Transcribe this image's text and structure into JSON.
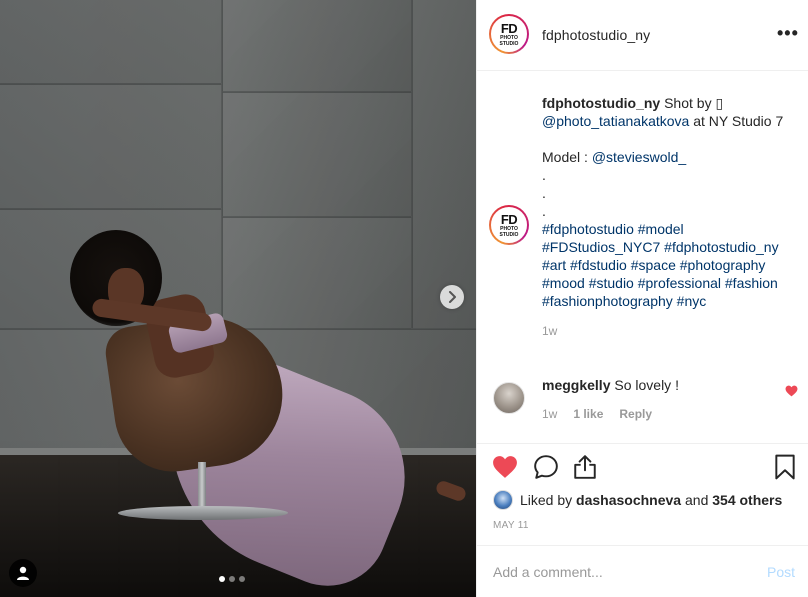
{
  "post": {
    "username": "fdphotostudio_ny",
    "avatar_logo": {
      "main": "FD",
      "sub_line1": "PHOTO",
      "sub_line2": "STUDIO"
    },
    "more_label": "•••"
  },
  "caption": {
    "username": "fdphotostudio_ny",
    "line1_text": " Shot by ",
    "camera_glyph": "▯",
    "photographer": "@photo_tatianakatkova",
    "location_text": " at NY Studio 7",
    "model_label": "Model : ",
    "model_handle": "@stevieswold_",
    "dots": [
      ".",
      ".",
      "."
    ],
    "hashtags": "#fdphotostudio #model #FDStudios_NYC7 #fdphotostudio_ny #art #fdstudio #space #photography #mood #studio #professional #fashion #fashionphotography #nyc",
    "time": "1w"
  },
  "comments": [
    {
      "username": "meggkelly",
      "text": " So lovely !",
      "time": "1w",
      "likes": "1 like",
      "reply": "Reply",
      "liked": true
    }
  ],
  "likes": {
    "prefix": "Liked by ",
    "user": "dashasochneva",
    "middle": " and ",
    "others": "354 others"
  },
  "date": "MAY 11",
  "add_comment": {
    "placeholder": "Add a comment...",
    "post_label": "Post"
  },
  "carousel": {
    "total": 3,
    "active": 1
  },
  "icons": {
    "like": "heart-icon",
    "comment": "comment-bubble-icon",
    "share": "share-icon",
    "save": "bookmark-icon",
    "next": "chevron-right-icon",
    "tag": "user-tag-icon"
  },
  "colors": {
    "like_red": "#ed4956",
    "link_blue": "#003569",
    "post_disabled": "#b3dbff",
    "muted": "#999999"
  }
}
